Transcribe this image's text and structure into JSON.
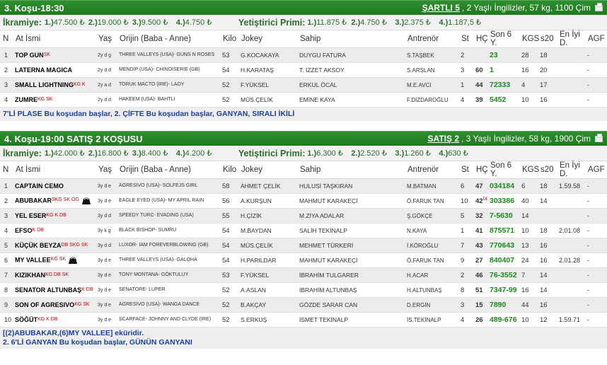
{
  "race1": {
    "title": "3. Koşu-18:30",
    "conditions_link": "ŞARTLI 5",
    "conditions_text": ", 2 Yaşlı İngilizler, 57 kg, 1100 Çim",
    "prize_label": "İkramiye:",
    "prizes": [
      {
        "n": "1.)",
        "v": "47.500 ₺"
      },
      {
        "n": "2.)",
        "v": "19.000 ₺"
      },
      {
        "n": "3.)",
        "v": "9.500 ₺"
      },
      {
        "n": "4.)",
        "v": "4.750 ₺"
      }
    ],
    "breeder_label": "Yetiştirici Primi:",
    "breeder_prizes": [
      {
        "n": "1.)",
        "v": "11.875 ₺"
      },
      {
        "n": "2.)",
        "v": "4.750 ₺"
      },
      {
        "n": "3.)",
        "v": "2.375 ₺"
      },
      {
        "n": "4.)",
        "v": "1.187,5 ₺"
      }
    ],
    "columns": [
      "N",
      "At İsmi",
      "Yaş",
      "Orijin (Baba - Anne)",
      "Kilo",
      "Jokey",
      "Sahip",
      "Antrenör",
      "St",
      "HÇ",
      "Son 6 Y.",
      "KGS",
      "s20",
      "En İyi D.",
      "AGF"
    ],
    "rows": [
      {
        "no": "1",
        "name": "TOP GUN",
        "sup": "SK",
        "age": "2y d g",
        "origin": "THREE VALLEYS (USA)- GUNS N ROSES",
        "kilo": "53",
        "jockey": "G.KOCAKAYA",
        "owner": "DUYGU FATURA",
        "trainer": "S.TAŞBEK",
        "st": "2",
        "hc": "",
        "last6": "23",
        "kgs": "28",
        "s20": "18",
        "best": "",
        "agf": "-"
      },
      {
        "no": "2",
        "name": "LATERNA MAGICA",
        "sup": "",
        "age": "2y d d",
        "origin": "MENDIP (USA)- CHINOISERIE (GB)",
        "kilo": "54",
        "jockey": "H.KARATAŞ",
        "owner": "T. İZZET AKSOY",
        "trainer": "S.ARSLAN",
        "st": "3",
        "hc": "60",
        "last6": "1",
        "kgs": "16",
        "s20": "20",
        "best": "",
        "agf": "-"
      },
      {
        "no": "3",
        "name": "SMALL LIGHTNING",
        "sup": "KG K",
        "age": "2y a d",
        "origin": "TORUK MACTO (IRE)- LADY",
        "kilo": "52",
        "jockey": "F.YÜKSEL",
        "owner": "ERKUL ÖCAL",
        "trainer": "M.E.AVCI",
        "st": "1",
        "hc": "44",
        "last6": "72333",
        "kgs": "4",
        "s20": "17",
        "best": "",
        "agf": "-"
      },
      {
        "no": "4",
        "name": "ZUMRE",
        "sup": "KG SK",
        "age": "2y d d",
        "origin": "HAKEEM (USA)- BAHTLI",
        "kilo": "52",
        "jockey": "MÜS.ÇELİK",
        "owner": "EMİNE KAYA",
        "trainer": "F.DİZDAROĞLU",
        "st": "4",
        "hc": "39",
        "last6": "5452",
        "kgs": "10",
        "s20": "16",
        "best": "",
        "agf": "-"
      }
    ],
    "info": "7'Lİ PLASE Bu koşudan başlar, 2. ÇİFTE Bu koşudan başlar, GANYAN, SIRALI İKİLİ"
  },
  "race2": {
    "title": "4. Koşu-19:00 SATIŞ 2 KOŞUSU",
    "conditions_link": "SATIŞ 2",
    "conditions_text": ", 3 Yaşlı İngilizler, 58 kg, 1900 Çim",
    "prize_label": "İkramiye:",
    "prizes": [
      {
        "n": "1.)",
        "v": "42.000 ₺"
      },
      {
        "n": "2.)",
        "v": "16.800 ₺"
      },
      {
        "n": "3.)",
        "v": "8.400 ₺"
      },
      {
        "n": "4.)",
        "v": "4.200 ₺"
      }
    ],
    "breeder_label": "Yetiştirici Primi:",
    "breeder_prizes": [
      {
        "n": "1.)",
        "v": "6.300 ₺"
      },
      {
        "n": "2.)",
        "v": "2.520 ₺"
      },
      {
        "n": "3.)",
        "v": "1.260 ₺"
      },
      {
        "n": "4.)",
        "v": "630 ₺"
      }
    ],
    "columns": [
      "N",
      "At İsmi",
      "Yaş",
      "Orijin (Baba - Anne)",
      "Kilo",
      "Jokey",
      "Sahip",
      "Antrenör",
      "St",
      "HÇ",
      "Son 6 Y.",
      "KGS",
      "s20",
      "En İyi D.",
      "AGF"
    ],
    "rows": [
      {
        "no": "1",
        "name": "CAPTAIN CEMO",
        "sup": "",
        "age": "3y d e",
        "origin": "AGRESIVO (USA)- SOLFEJS GIRL",
        "kilo": "58",
        "jockey": "AHMET ÇELİK",
        "owner": "HULUSİ TAŞKIRAN",
        "trainer": "M.BATMAN",
        "st": "6",
        "hc": "47",
        "hcsup": "",
        "last6": "034184",
        "kgs": "6",
        "s20": "18",
        "best": "1.59.58",
        "agf": "-"
      },
      {
        "no": "2",
        "name": "ABUBAKAR",
        "sup": "SKG SK ÖG",
        "age": "3y d e",
        "origin": "EAGLE EYED (USA)- MY APRIL RAIN",
        "kilo": "56",
        "jockey": "A.KURŞUN",
        "owner": "MAHMUT KARAKEÇİ",
        "trainer": "Ö.FARUK TAN",
        "st": "10",
        "hc": "42",
        "hcsup": "DB",
        "last6": "303386",
        "kgs": "40",
        "s20": "14",
        "best": "",
        "agf": "-"
      },
      {
        "no": "3",
        "name": "YEL ESER",
        "sup": "KG K DB",
        "age": "3y d d",
        "origin": "SPEEDY TURC- EVADING (USA)",
        "kilo": "55",
        "jockey": "H.ÇİZİK",
        "owner": "M.ZİYA ADALAR",
        "trainer": "Ş.GÖKÇE",
        "st": "5",
        "hc": "32",
        "hcsup": "",
        "last6": "7-5630",
        "kgs": "14",
        "s20": "",
        "best": "",
        "agf": "-"
      },
      {
        "no": "4",
        "name": "EFSO",
        "sup": "K DB",
        "age": "3y k g",
        "origin": "BLACK BISHOP- SUMRU",
        "kilo": "54",
        "jockey": "M.BAYDAN",
        "owner": "SALİH TEKİNALP",
        "trainer": "N.KAYA",
        "st": "1",
        "hc": "41",
        "hcsup": "",
        "last6": "875571",
        "kgs": "10",
        "s20": "18",
        "best": "2.01.08",
        "agf": "-"
      },
      {
        "no": "5",
        "name": "KÜÇÜK BEYZA",
        "sup": "DB SKG SK",
        "age": "3y d d",
        "origin": "LUXOR- IAM FOREVERBLOWING (GB)",
        "kilo": "54",
        "jockey": "MÜS.ÇELİK",
        "owner": "MEHMET TÜRKERİ",
        "trainer": "İ.KÖROĞLU",
        "st": "7",
        "hc": "43",
        "hcsup": "",
        "last6": "770643",
        "kgs": "13",
        "s20": "16",
        "best": "",
        "agf": "-"
      },
      {
        "no": "6",
        "name": "MY VALLEE",
        "sup": "KG SK",
        "age": "3y d e",
        "origin": "THREE VALLEYS (USA)- GALOHA",
        "kilo": "54",
        "jockey": "H.PARILDAR",
        "owner": "MAHMUT KARAKEÇİ",
        "trainer": "Ö.FARUK TAN",
        "st": "9",
        "hc": "27",
        "hcsup": "",
        "last6": "840407",
        "kgs": "24",
        "s20": "16",
        "best": "2.01.28",
        "agf": "-"
      },
      {
        "no": "7",
        "name": "KIZIKHAN",
        "sup": "KG DB SK",
        "age": "3y d e",
        "origin": "TONY MONTANA- GÖKTULUY",
        "kilo": "53",
        "jockey": "F.YÜKSEL",
        "owner": "İBRAHİM TULGARER",
        "trainer": "H.ACAR",
        "st": "2",
        "hc": "46",
        "hcsup": "",
        "last6": "76-3552",
        "kgs": "7",
        "s20": "14",
        "best": "",
        "agf": "-"
      },
      {
        "no": "8",
        "name": "SENATOR ALTUNBAŞ",
        "sup": "K DB",
        "age": "3y d e",
        "origin": "SENATORE- LUPER",
        "kilo": "52",
        "jockey": "A.ASLAN",
        "owner": "İBRAHİM ALTUNBAŞ",
        "trainer": "H.ALTUNBAŞ",
        "st": "8",
        "hc": "51",
        "hcsup": "",
        "last6": "7347-99",
        "kgs": "16",
        "s20": "14",
        "best": "",
        "agf": "-"
      },
      {
        "no": "9",
        "name": "SON OF AGRESIVO",
        "sup": "KG SK",
        "age": "3y d e",
        "origin": "AGRESIVO (USA)- WANGA DANCE",
        "kilo": "52",
        "jockey": "B.AKÇAY",
        "owner": "GÖZDE SARAR CAN",
        "trainer": "D.ERGİN",
        "st": "3",
        "hc": "15",
        "hcsup": "",
        "last6": "7890",
        "kgs": "44",
        "s20": "16",
        "best": "",
        "agf": "-"
      },
      {
        "no": "10",
        "name": "SÖĞÜT",
        "sup": "KG K DB",
        "age": "3y d e",
        "origin": "SCARFACE- JOHNNY AND CLYDE (IRE)",
        "kilo": "52",
        "jockey": "S.ERKUŞ",
        "owner": "İSMET TEKİNALP",
        "trainer": "İS.TEKİNALP",
        "st": "4",
        "hc": "26",
        "hcsup": "",
        "last6": "489-676",
        "kgs": "10",
        "s20": "12",
        "best": "1.59.71",
        "agf": "-"
      }
    ],
    "info": "[(2)ABUBAKAR,(6)MY VALLEE] eküridir.",
    "info2": "2. 6'Lİ GANYAN Bu koşudan başlar, GÜNÜN GANYANI"
  },
  "colors": {
    "header_green": "#2f8f2f",
    "text_green": "#2a6e2a",
    "form_green": "#1a8a1a",
    "info_blue": "#1a3fa8",
    "superscript_red": "#c00"
  }
}
